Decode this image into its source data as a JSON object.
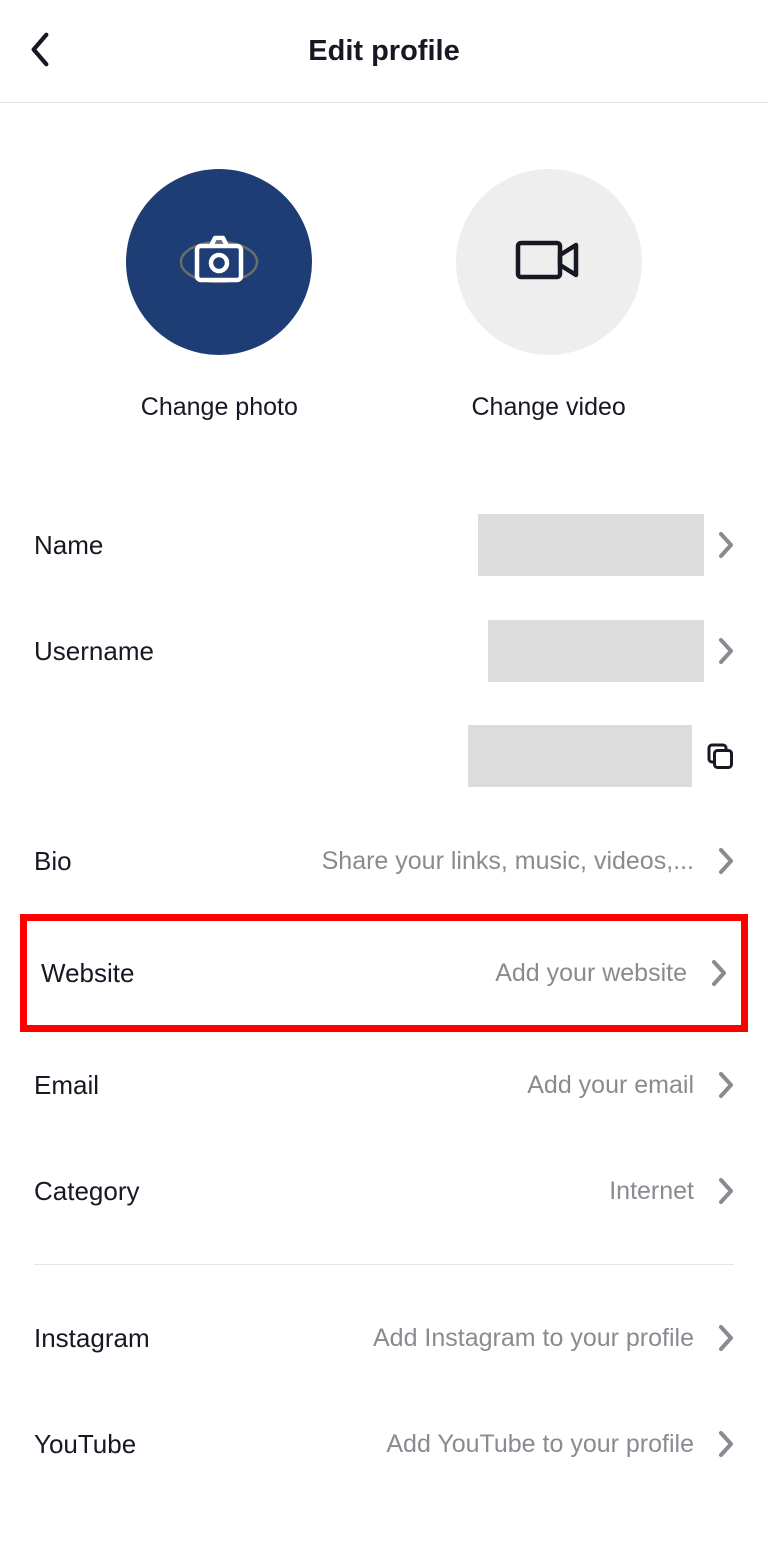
{
  "header": {
    "title": "Edit profile"
  },
  "media": {
    "photo_label": "Change photo",
    "video_label": "Change video"
  },
  "rows": {
    "name": {
      "label": "Name",
      "value": ""
    },
    "username": {
      "label": "Username",
      "value": ""
    },
    "link": {
      "label": "",
      "value": ""
    },
    "bio": {
      "label": "Bio",
      "value": "Share your links, music, videos,..."
    },
    "website": {
      "label": "Website",
      "value": "Add your website"
    },
    "email": {
      "label": "Email",
      "value": "Add your email"
    },
    "category": {
      "label": "Category",
      "value": "Internet"
    },
    "instagram": {
      "label": "Instagram",
      "value": "Add Instagram to your profile"
    },
    "youtube": {
      "label": "YouTube",
      "value": "Add YouTube to your profile"
    }
  },
  "highlight": "website"
}
